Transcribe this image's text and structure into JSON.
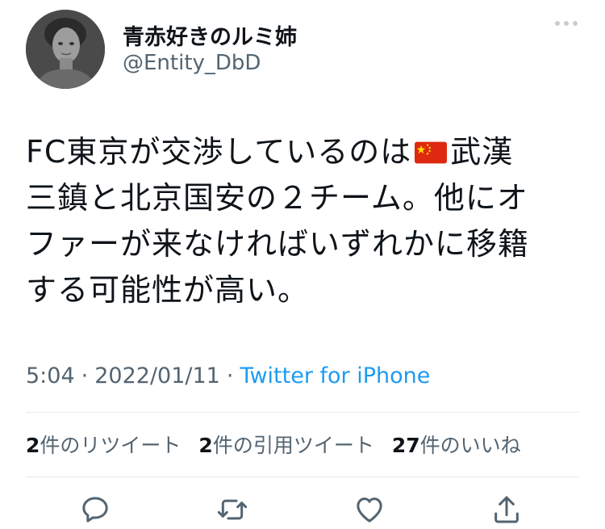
{
  "author": {
    "display_name": "青赤好きのルミ姉",
    "handle": "@Entity_DbD"
  },
  "tweet": {
    "line1_a": "FC東京が交渉しているのは",
    "line1_b": "武漢",
    "line2": "三鎮と北京国安の２チーム。他にオ",
    "line3": "ファーが来なければいずれかに移籍",
    "line4": "する可能性が高い。",
    "flag_icon": "china-flag-icon"
  },
  "meta": {
    "time": "5:04",
    "date": "2022/01/11",
    "separator": "·",
    "source": "Twitter for iPhone"
  },
  "stats": {
    "retweets_count": "2",
    "retweets_label": "件のリツイート",
    "quotes_count": "2",
    "quotes_label": "件の引用ツイート",
    "likes_count": "27",
    "likes_label": "件のいいね"
  },
  "actions": [
    "reply-icon",
    "retweet-icon",
    "like-icon",
    "share-icon"
  ],
  "colors": {
    "text": "#0f1419",
    "secondary": "#536471",
    "link": "#1d9bf0",
    "divider": "#e6e9eb",
    "flag_red": "#de2910",
    "flag_star": "#ffde00"
  }
}
